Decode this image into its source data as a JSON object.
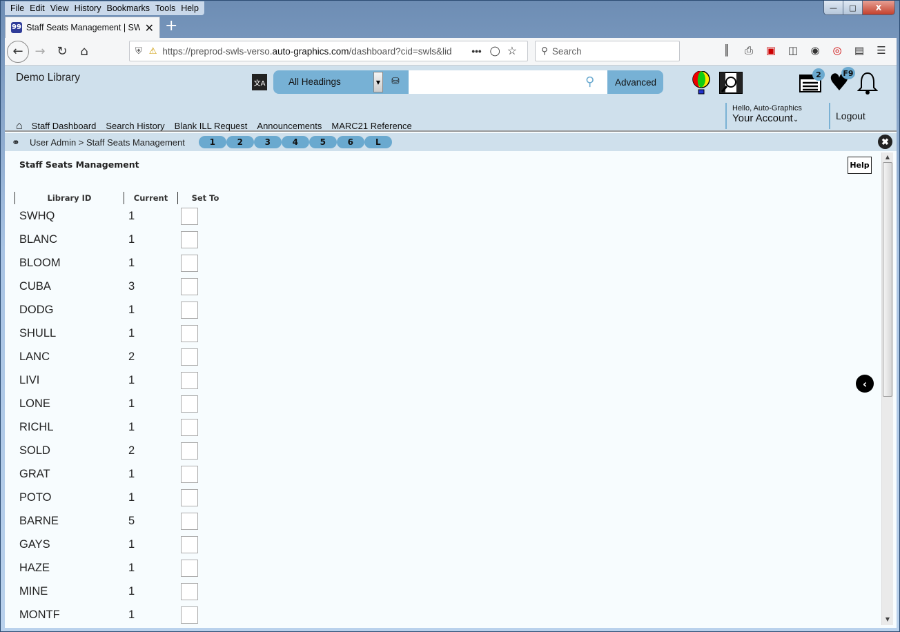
{
  "browser": {
    "menu": [
      "File",
      "Edit",
      "View",
      "History",
      "Bookmarks",
      "Tools",
      "Help"
    ],
    "tab_title": "Staff Seats Management | SWLS",
    "url_prefix": "https://preprod-swls-verso.",
    "url_domain": "auto-graphics.com",
    "url_suffix": "/dashboard?cid=swls&lid",
    "search_placeholder": "Search"
  },
  "header": {
    "library_name": "Demo Library",
    "search_scope": "All Headings",
    "search_value": "",
    "advanced_label": "Advanced",
    "list_badge": "2",
    "favorites_badge": "F9",
    "greeting": "Hello, Auto-Graphics",
    "account_label": "Your Account",
    "logout_label": "Logout"
  },
  "nav": {
    "items": [
      "Staff Dashboard",
      "Search History",
      "Blank ILL Request",
      "Announcements",
      "MARC21 Reference"
    ],
    "active": "Staff Dashboard"
  },
  "breadcrumb": {
    "text": "User Admin > Staff Seats Management",
    "pills": [
      "1",
      "2",
      "3",
      "4",
      "5",
      "6",
      "L"
    ]
  },
  "main": {
    "title": "Staff Seats Management",
    "help_label": "Help",
    "columns": [
      "Library ID",
      "Current",
      "Set To"
    ],
    "rows": [
      {
        "id": "SWHQ",
        "current": "1",
        "set_to": ""
      },
      {
        "id": "BLANC",
        "current": "1",
        "set_to": ""
      },
      {
        "id": "BLOOM",
        "current": "1",
        "set_to": ""
      },
      {
        "id": "CUBA",
        "current": "3",
        "set_to": ""
      },
      {
        "id": "DODG",
        "current": "1",
        "set_to": ""
      },
      {
        "id": "SHULL",
        "current": "1",
        "set_to": ""
      },
      {
        "id": "LANC",
        "current": "2",
        "set_to": ""
      },
      {
        "id": "LIVI",
        "current": "1",
        "set_to": ""
      },
      {
        "id": "LONE",
        "current": "1",
        "set_to": ""
      },
      {
        "id": "RICHL",
        "current": "1",
        "set_to": ""
      },
      {
        "id": "SOLD",
        "current": "2",
        "set_to": ""
      },
      {
        "id": "GRAT",
        "current": "1",
        "set_to": ""
      },
      {
        "id": "POTO",
        "current": "1",
        "set_to": ""
      },
      {
        "id": "BARNE",
        "current": "5",
        "set_to": ""
      },
      {
        "id": "GAYS",
        "current": "1",
        "set_to": ""
      },
      {
        "id": "HAZE",
        "current": "1",
        "set_to": ""
      },
      {
        "id": "MINE",
        "current": "1",
        "set_to": ""
      },
      {
        "id": "MONTF",
        "current": "1",
        "set_to": ""
      }
    ]
  }
}
